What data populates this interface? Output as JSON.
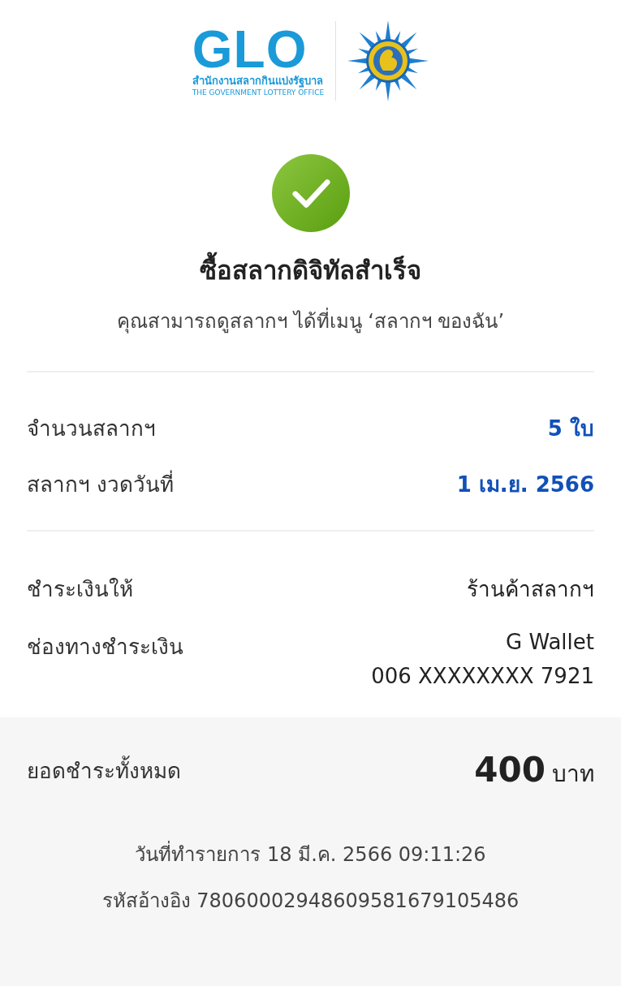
{
  "header": {
    "logo_text": "GLO",
    "org_thai": "สำนักงานสลากกินแบ่งรัฐบาล",
    "org_english": "THE GOVERNMENT LOTTERY OFFICE"
  },
  "status": {
    "kind": "success",
    "title": "ซื้อสลากดิจิทัลสำเร็จ",
    "message": "คุณสามารถดูสลากฯ ได้ที่เมนู ‘สลากฯ ของฉัน’"
  },
  "ticket_details": [
    {
      "label": "จำนวนสลากฯ",
      "values": [
        "5 ใบ"
      ],
      "kind": "highlight"
    },
    {
      "label": "สลากฯ งวดวันที่",
      "values": [
        "1 เม.ย. 2566"
      ],
      "kind": "highlight"
    }
  ],
  "payment_details": [
    {
      "label": "ชำระเงินให้",
      "values": [
        "ร้านค้าสลากฯ"
      ],
      "kind": "plain"
    },
    {
      "label": "ช่องทางชำระเงิน",
      "values": [
        "G Wallet",
        "006 XXXXXXXX 7921"
      ],
      "kind": "plain"
    }
  ],
  "summary": {
    "total_label": "ยอดชำระทั้งหมด",
    "total_amount": "400",
    "currency": "บาท",
    "transaction_date": "วันที่ทำรายการ 18 มี.ค. 2566 09:11:26",
    "reference": "รหัสอ้างอิง 78060002948609581679105486"
  }
}
